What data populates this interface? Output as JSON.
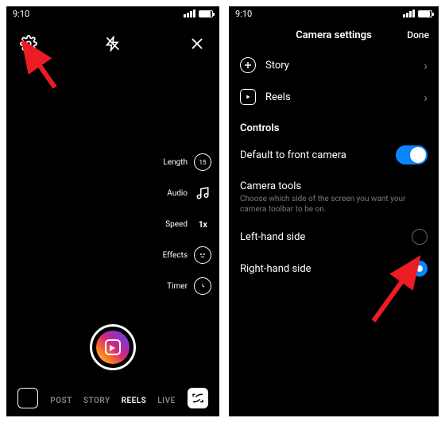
{
  "status": {
    "time": "9:10"
  },
  "left": {
    "tools": {
      "length": {
        "label": "Length",
        "value": "15"
      },
      "audio": {
        "label": "Audio"
      },
      "speed": {
        "label": "Speed",
        "value": "1x"
      },
      "effects": {
        "label": "Effects"
      },
      "timer": {
        "label": "Timer"
      }
    },
    "tabs": {
      "post": "POST",
      "story": "STORY",
      "reels": "REELS",
      "live": "LIVE"
    }
  },
  "right": {
    "header": {
      "title": "Camera settings",
      "done": "Done"
    },
    "nav": {
      "story": "Story",
      "reels": "Reels"
    },
    "controls": {
      "heading": "Controls",
      "front_cam": "Default to front camera",
      "tools_title": "Camera tools",
      "tools_hint": "Choose which side of the screen you want your camera toolbar to be on.",
      "left_side": "Left-hand side",
      "right_side": "Right-hand side"
    }
  }
}
